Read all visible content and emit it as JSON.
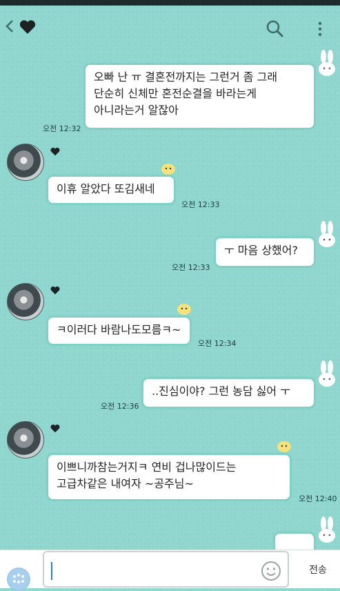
{
  "header": {
    "back_icon": "chevron-left-icon",
    "chat_icon": "heart-icon",
    "search_icon": "search-icon",
    "more_icon": "more-vertical-icon"
  },
  "messages": [
    {
      "side": "me",
      "text": "오빠 난 ㅠ 결혼전까지는 그런거 좀 그래\n단순히 신체만 혼전순결을 바라는게\n아니라는거 알잖아",
      "time": "오전 12:32"
    },
    {
      "side": "them",
      "text": "이휴 알았다 또김새네",
      "time": "오전 12:33"
    },
    {
      "side": "me",
      "text": "ㅜ 마음 상했어?",
      "time": "오전 12:33"
    },
    {
      "side": "them",
      "text": "ㅋ이러다 바람나도모름ㅋ~",
      "time": "오전 12:34"
    },
    {
      "side": "me",
      "text": "..진심이야? 그런 농담 싫어 ㅜ",
      "time": "오전 12:36"
    },
    {
      "side": "them",
      "text": "이쁘니까참는거지ㅋ 연비 겁나많이드는\n고급차같은 내여자 ~공주님~",
      "time": "오전 12:40"
    },
    {
      "side": "me",
      "text": "",
      "time": ""
    }
  ],
  "input": {
    "value": "",
    "send_label": "전송",
    "emoji_icon": "smiley-icon",
    "attach_icon": "attachment-icon"
  },
  "colors": {
    "background": "#8fd6cf",
    "bubble_border": "#7ed1c4",
    "bubble_fill": "#ffffff"
  }
}
